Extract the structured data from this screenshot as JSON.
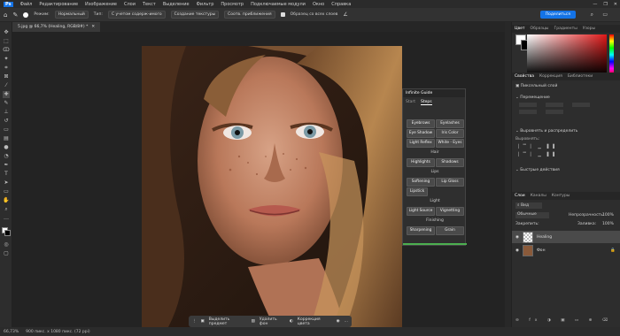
{
  "menu": [
    "Файл",
    "Редактирование",
    "Изображение",
    "Слои",
    "Текст",
    "Выделение",
    "Фильтр",
    "Просмотр",
    "Подключаемые модули",
    "Окно",
    "Справка"
  ],
  "options": {
    "mode_label": "Режим:",
    "mode_value": "Нормальный",
    "type_label": "Тип:",
    "btn_content_aware": "С учетом содерж-имого",
    "btn_texture": "Создание текстуры",
    "btn_proximity": "Соотв. приближения",
    "sample_all": "Образец со всех слоев",
    "share": "Поделиться"
  },
  "doc_tab": "5.jpg @ 66,7% (Healing, RGB/8#) *",
  "status": {
    "zoom": "66,73%",
    "info": "900 пикс. x 1080 пикс. (72 ppi)"
  },
  "context_bar": {
    "select_subject": "Выделить предмет",
    "remove_bg": "Удалить фон",
    "color_correction": "Коррекция цвета"
  },
  "guide": {
    "title": "Infinite Guide",
    "tab_start": "Start",
    "tab_steps": "Steps",
    "eyebrows": "Eyebrows",
    "eyelashes": "Eyelashes",
    "eye_shadow": "Eye Shadow",
    "iris_color": "Iris Color",
    "light_reflex": "Light Reflex",
    "white_eyes": "White - Eyes",
    "hair": "Hair",
    "highlights": "Highlights",
    "shadows": "Shadows",
    "lips": "Lips",
    "softening": "Softening",
    "lip_gloss": "Lip Gloss",
    "lipstick": "Lipstick",
    "light": "Light",
    "light_source": "Light Source",
    "vignetting": "Vignetting",
    "finishing": "Finishing",
    "sharpening": "Sharpening",
    "grain": "Grain"
  },
  "color_panel": {
    "tab_color": "Цвет",
    "tab_swatches": "Образцы",
    "tab_gradients": "Градиенты",
    "tab_patterns": "Узоры",
    "field_color": "#e01818"
  },
  "properties": {
    "tab_props": "Свойства",
    "tab_corrections": "Коррекция",
    "tab_libraries": "Библиотеки",
    "pixel_layer": "Пиксельный слой",
    "transform": "Перемещение",
    "align": "Выровнять и распределить",
    "align_label": "Выровнять:",
    "quick_actions": "Быстрые действия"
  },
  "layers": {
    "tab_layers": "Слои",
    "tab_channels": "Каналы",
    "tab_contours": "Контуры",
    "search_kind": "Вид",
    "blend": "Обычные",
    "opacity_label": "Непрозрачность:",
    "opacity": "100%",
    "lock_label": "Закрепить:",
    "fill_label": "Заливка:",
    "fill": "100%",
    "items": [
      {
        "name": "Healing"
      },
      {
        "name": "Фон"
      }
    ]
  }
}
